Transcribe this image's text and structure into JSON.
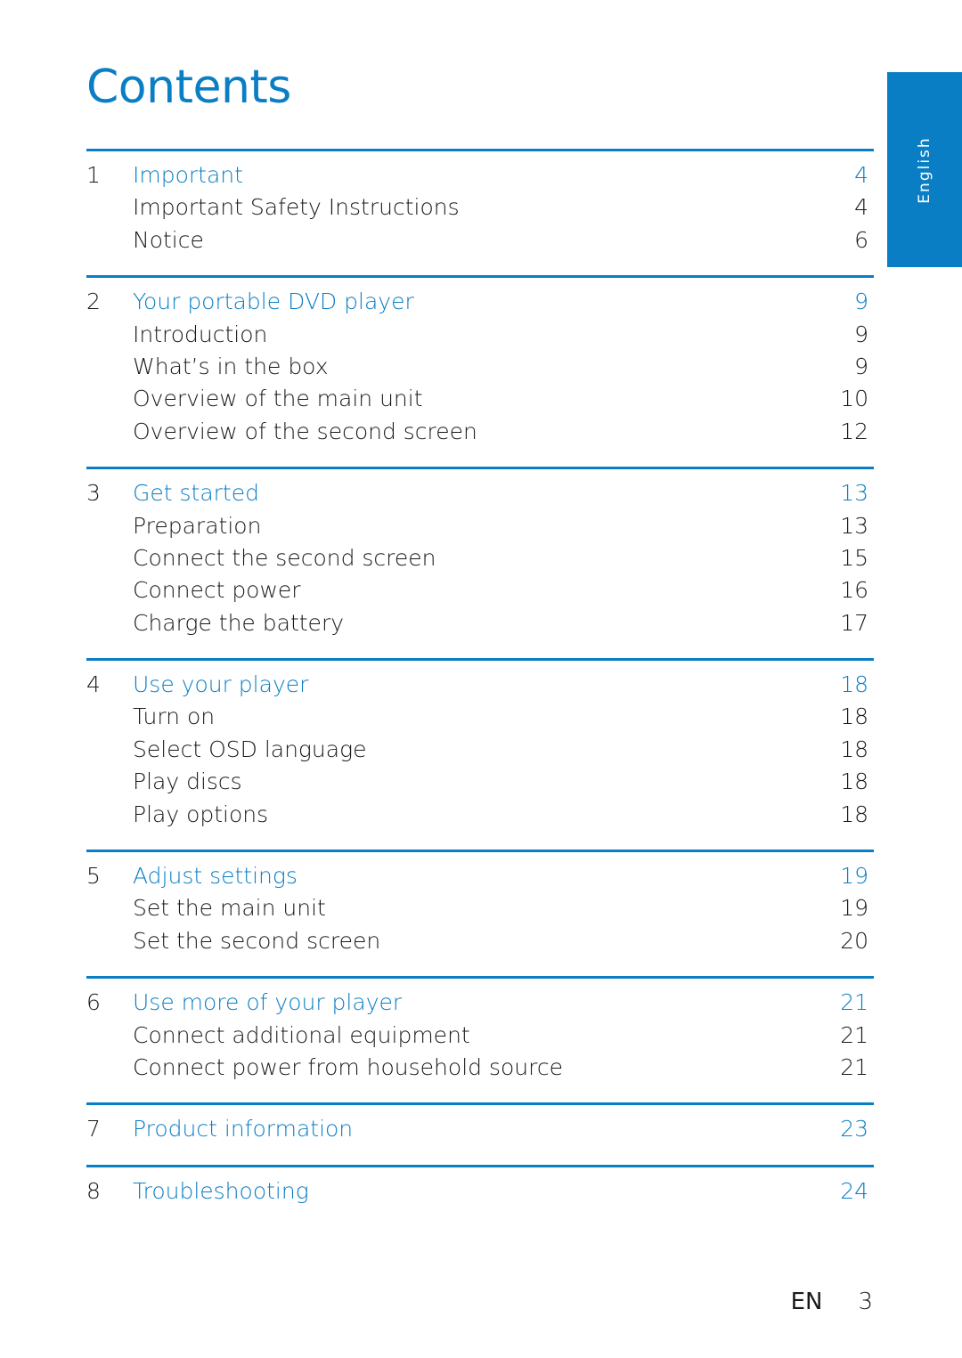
{
  "title": "Contents",
  "language_tab": "English",
  "accent_color": "#0a7ec4",
  "sections": [
    {
      "num": "1",
      "title": "Important",
      "page": "4",
      "items": [
        {
          "label": "Important Safety Instructions",
          "page": "4"
        },
        {
          "label": "Notice",
          "page": "6"
        }
      ]
    },
    {
      "num": "2",
      "title": "Your portable DVD player",
      "page": "9",
      "items": [
        {
          "label": "Introduction",
          "page": "9"
        },
        {
          "label": "What’s in the box",
          "page": "9"
        },
        {
          "label": "Overview of the main unit",
          "page": "10"
        },
        {
          "label": "Overview of the second screen",
          "page": "12"
        }
      ]
    },
    {
      "num": "3",
      "title": "Get started",
      "page": "13",
      "items": [
        {
          "label": "Preparation",
          "page": "13"
        },
        {
          "label": "Connect the second screen",
          "page": "15"
        },
        {
          "label": "Connect power",
          "page": "16"
        },
        {
          "label": "Charge the battery",
          "page": "17"
        }
      ]
    },
    {
      "num": "4",
      "title": "Use your player",
      "page": "18",
      "items": [
        {
          "label": "Turn on",
          "page": "18"
        },
        {
          "label": "Select OSD language",
          "page": "18"
        },
        {
          "label": "Play discs",
          "page": "18"
        },
        {
          "label": "Play options",
          "page": "18"
        }
      ]
    },
    {
      "num": "5",
      "title": "Adjust settings",
      "page": "19",
      "items": [
        {
          "label": "Set the main unit",
          "page": "19"
        },
        {
          "label": "Set the second screen",
          "page": "20"
        }
      ]
    },
    {
      "num": "6",
      "title": "Use more of your player",
      "page": "21",
      "items": [
        {
          "label": "Connect additional equipment",
          "page": "21"
        },
        {
          "label": "Connect power from household source",
          "page": "21"
        }
      ]
    },
    {
      "num": "7",
      "title": "Product information",
      "page": "23",
      "items": []
    },
    {
      "num": "8",
      "title": "Troubleshooting",
      "page": "24",
      "items": []
    }
  ],
  "footer": {
    "lang": "EN",
    "page": "3"
  }
}
